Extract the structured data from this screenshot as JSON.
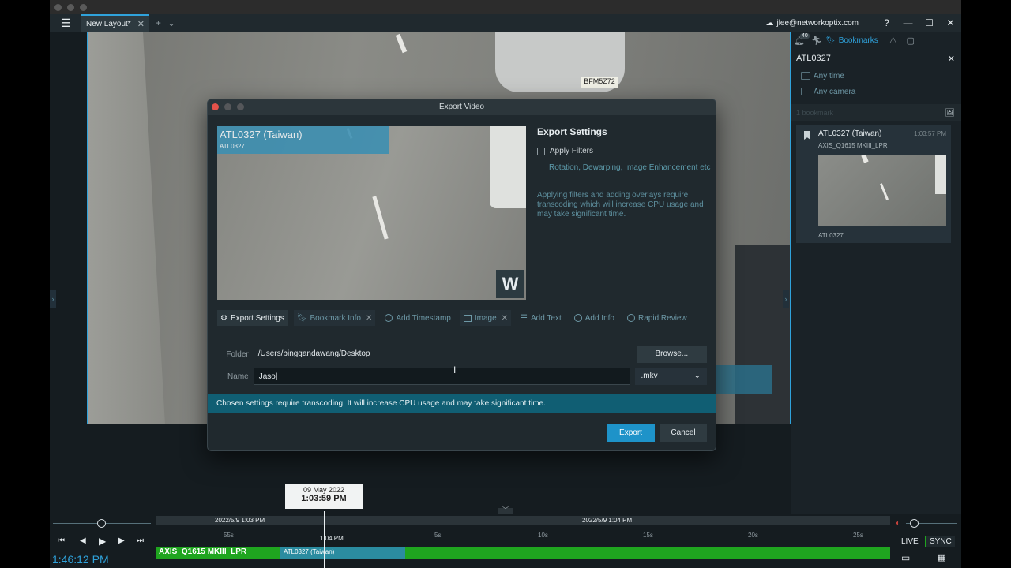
{
  "header": {
    "tab_label": "New Layout*",
    "user": "jlee@networkoptix.com",
    "notifications_count": "40",
    "bookmarks_tab": "Bookmarks"
  },
  "bookmarks_panel": {
    "title": "ATL0327",
    "filter_time": "Any time",
    "filter_camera": "Any camera",
    "count": "1 bookmark",
    "card": {
      "title": "ATL0327 (Taiwan)",
      "time": "1:03:57 PM",
      "camera": "AXIS_Q1615 MKIII_LPR",
      "footer": "ATL0327"
    }
  },
  "video": {
    "plate": "BFM5Z72"
  },
  "dialog": {
    "title": "Export Video",
    "preview_caption_title": "ATL0327 (Taiwan)",
    "preview_caption_sub": "ATL0327",
    "watermark": "W",
    "settings_heading": "Export Settings",
    "apply_filters_label": "Apply Filters",
    "filters_detail": "Rotation, Dewarping, Image Enhancement etc",
    "note": "Applying filters and adding overlays require transcoding which will increase CPU usage and may take significant time.",
    "option_tabs": {
      "export_settings": "Export Settings",
      "bookmark_info": "Bookmark Info",
      "add_timestamp": "Add Timestamp",
      "image": "Image",
      "add_text": "Add Text",
      "add_info": "Add Info",
      "rapid_review": "Rapid Review"
    },
    "folder_label": "Folder",
    "folder_value": "/Users/binggandawang/Desktop",
    "browse_label": "Browse...",
    "name_label": "Name",
    "name_value": "Jaso",
    "format_value": ".mkv",
    "warning": "Chosen settings require transcoding. It will increase CPU usage and may take significant time.",
    "export_button": "Export",
    "cancel_button": "Cancel"
  },
  "timeline": {
    "tooltip_date": "09 May 2022",
    "tooltip_time": "1:03:59 PM",
    "top_label_1": "2022/5/9 1:03 PM",
    "top_label_2": "2022/5/9 1:04 PM",
    "ticks": [
      "55s",
      "1:04 PM",
      "5s",
      "10s",
      "15s",
      "20s",
      "25s"
    ],
    "track_camera": "AXIS_Q1615 MKIII_LPR",
    "track_bookmark": "ATL0327 (Taiwan)",
    "live_label": "LIVE",
    "sync_label": "SYNC",
    "clock": "1:46:12 PM"
  }
}
